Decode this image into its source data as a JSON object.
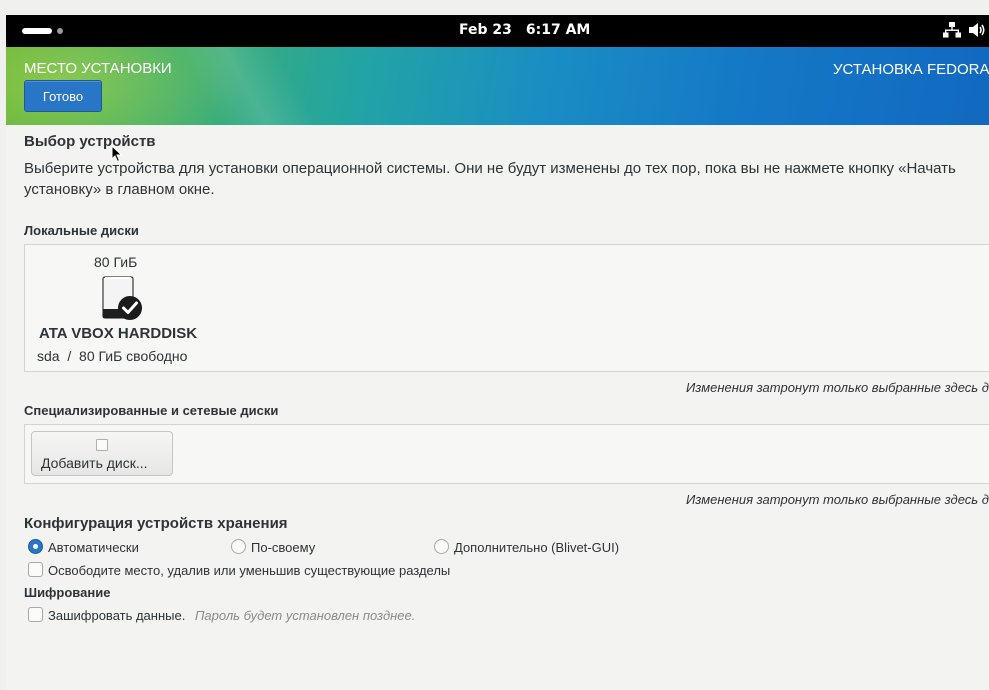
{
  "topbar": {
    "date": "Feb 23",
    "time": "6:17 AM",
    "tray_icons": [
      "network-icon",
      "volume-icon"
    ]
  },
  "header": {
    "spoke_title": "МЕСТО УСТАНОВКИ",
    "done_label": "Готово",
    "product_title": "УСТАНОВКА FEDORA",
    "colors": {
      "banner_start": "#5fb036",
      "banner_end": "#1269c0",
      "done_button": "#2a76c6"
    }
  },
  "device_selection": {
    "heading": "Выбор устройств",
    "description": "Выберите устройства для установки операционной системы. Они не будут изменены до тех пор, пока вы не нажмете кнопку «Начать установку» в главном окне."
  },
  "local_disks": {
    "heading": "Локальные диски",
    "disks": [
      {
        "size": "80 ГиБ",
        "name": "ATA VBOX HARDDISK",
        "device": "sda",
        "separator": "/",
        "free": "80 ГиБ свободно",
        "selected": true
      }
    ],
    "note": "Изменения затронут только выбранные здесь диски."
  },
  "special_disks": {
    "heading": "Специализированные и сетевые диски",
    "add_label": "Добавить диск...",
    "note": "Изменения затронут только выбранные здесь диски."
  },
  "storage_config": {
    "heading": "Конфигурация устройств хранения",
    "options": [
      {
        "label": "Автоматически",
        "selected": true
      },
      {
        "label": "По-своему",
        "selected": false
      },
      {
        "label": "Дополнительно (Blivet-GUI)",
        "selected": false
      }
    ],
    "reclaim_label": "Освободите место, удалив или уменьшив существующие разделы",
    "reclaim_checked": false
  },
  "encryption": {
    "heading": "Шифрование",
    "encrypt_label": "Зашифровать данные.",
    "encrypt_hint": "Пароль будет установлен позднее.",
    "encrypt_checked": false
  }
}
